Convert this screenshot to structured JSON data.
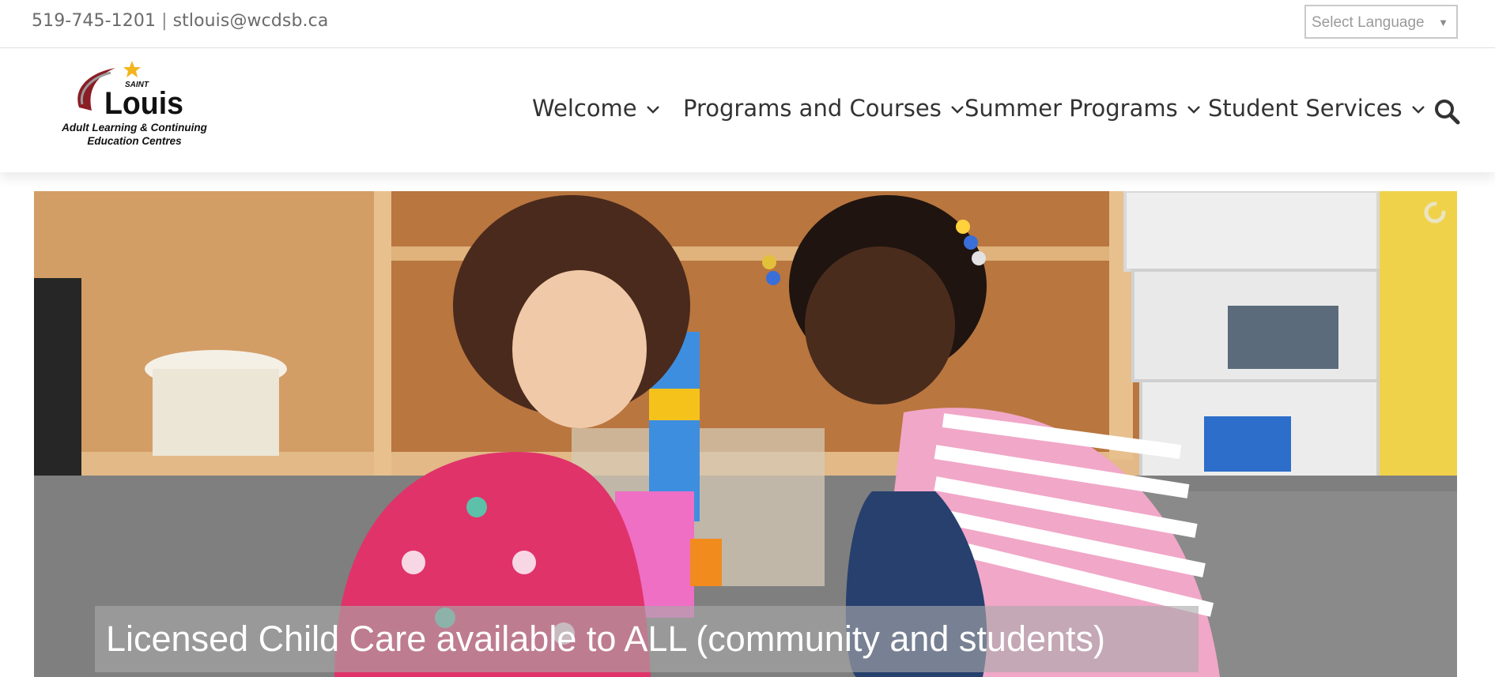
{
  "topbar": {
    "phone": "519-745-1201",
    "separator": "|",
    "email": "stlouis@wcdsb.ca",
    "language_select": {
      "placeholder": "Select Language"
    }
  },
  "logo": {
    "saint": "SAINT",
    "name": "Louis",
    "tagline_1": "Adult Learning & Continuing",
    "tagline_2": "Education Centres"
  },
  "nav": {
    "items": [
      {
        "label": "Welcome"
      },
      {
        "label": "Programs and Courses"
      },
      {
        "label": "Summer Programs"
      },
      {
        "label": "Student Services"
      }
    ]
  },
  "hero": {
    "caption": "Licensed Child Care available to ALL (community and students)"
  },
  "colors": {
    "accent_star": "#f2b51c",
    "logo_red": "#8b1d24",
    "caption_bg": "#aaaaaa",
    "nav_text": "#333333"
  },
  "icons": [
    "search-icon",
    "chevron-down-icon",
    "star-icon",
    "loading-spinner-icon"
  ]
}
